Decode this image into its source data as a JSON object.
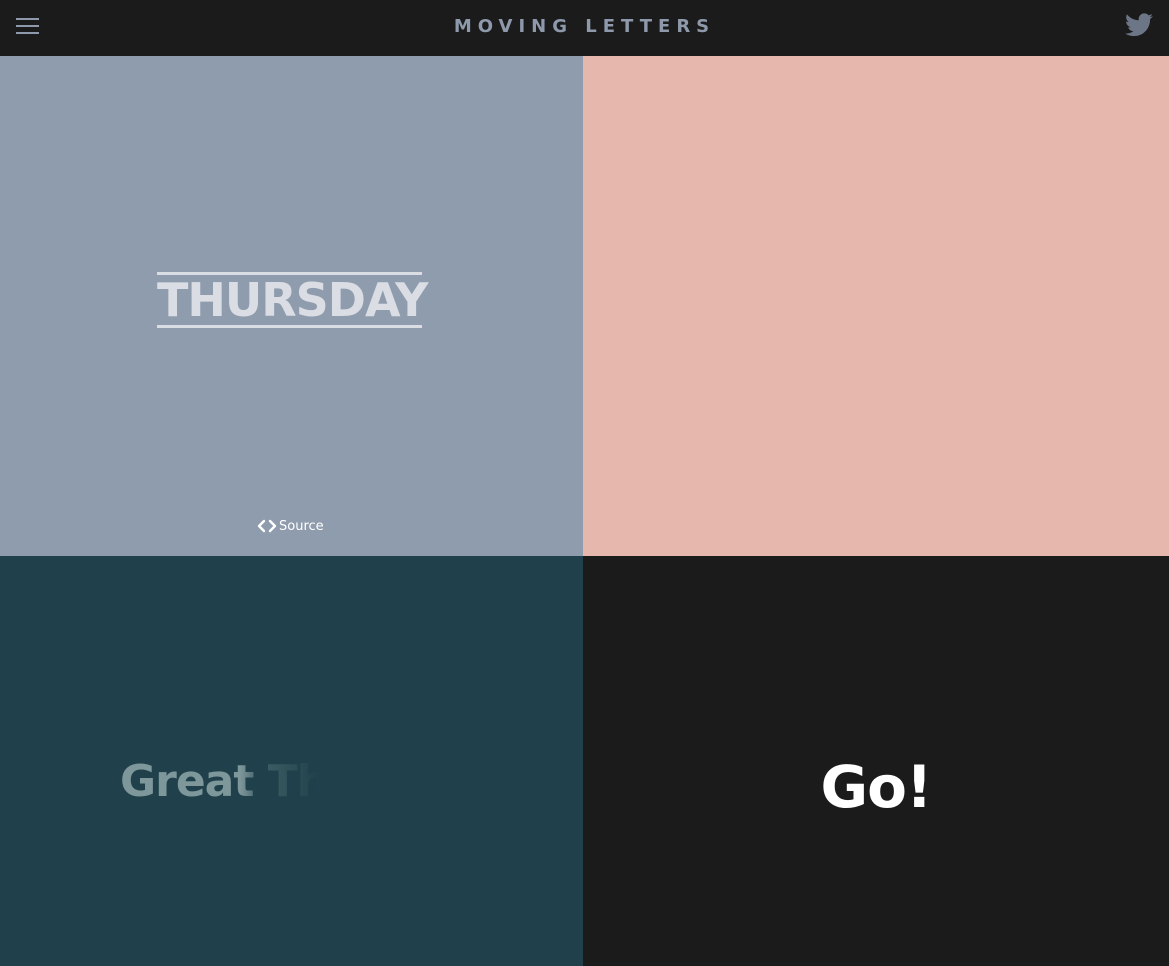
{
  "header": {
    "title": "MOVING LETTERS",
    "menu_icon": "hamburger-menu-icon",
    "social_icon": "twitter-icon",
    "background": "#1b1b1b",
    "title_color": "#8e9aab",
    "icon_color": "#6d7686"
  },
  "tiles": [
    {
      "word": "THURSDAY",
      "background": "#8f9cad",
      "text_color": "#dadde3",
      "source_label": "Source",
      "source_icon": "code-brackets-icon"
    },
    {
      "word": "",
      "background": "#e6b8ad"
    },
    {
      "word": "Great Th",
      "background": "#20414b",
      "text_color": "#7d979a"
    },
    {
      "word": "Go!",
      "background": "#1b1b1b",
      "text_color": "#ffffff"
    }
  ]
}
